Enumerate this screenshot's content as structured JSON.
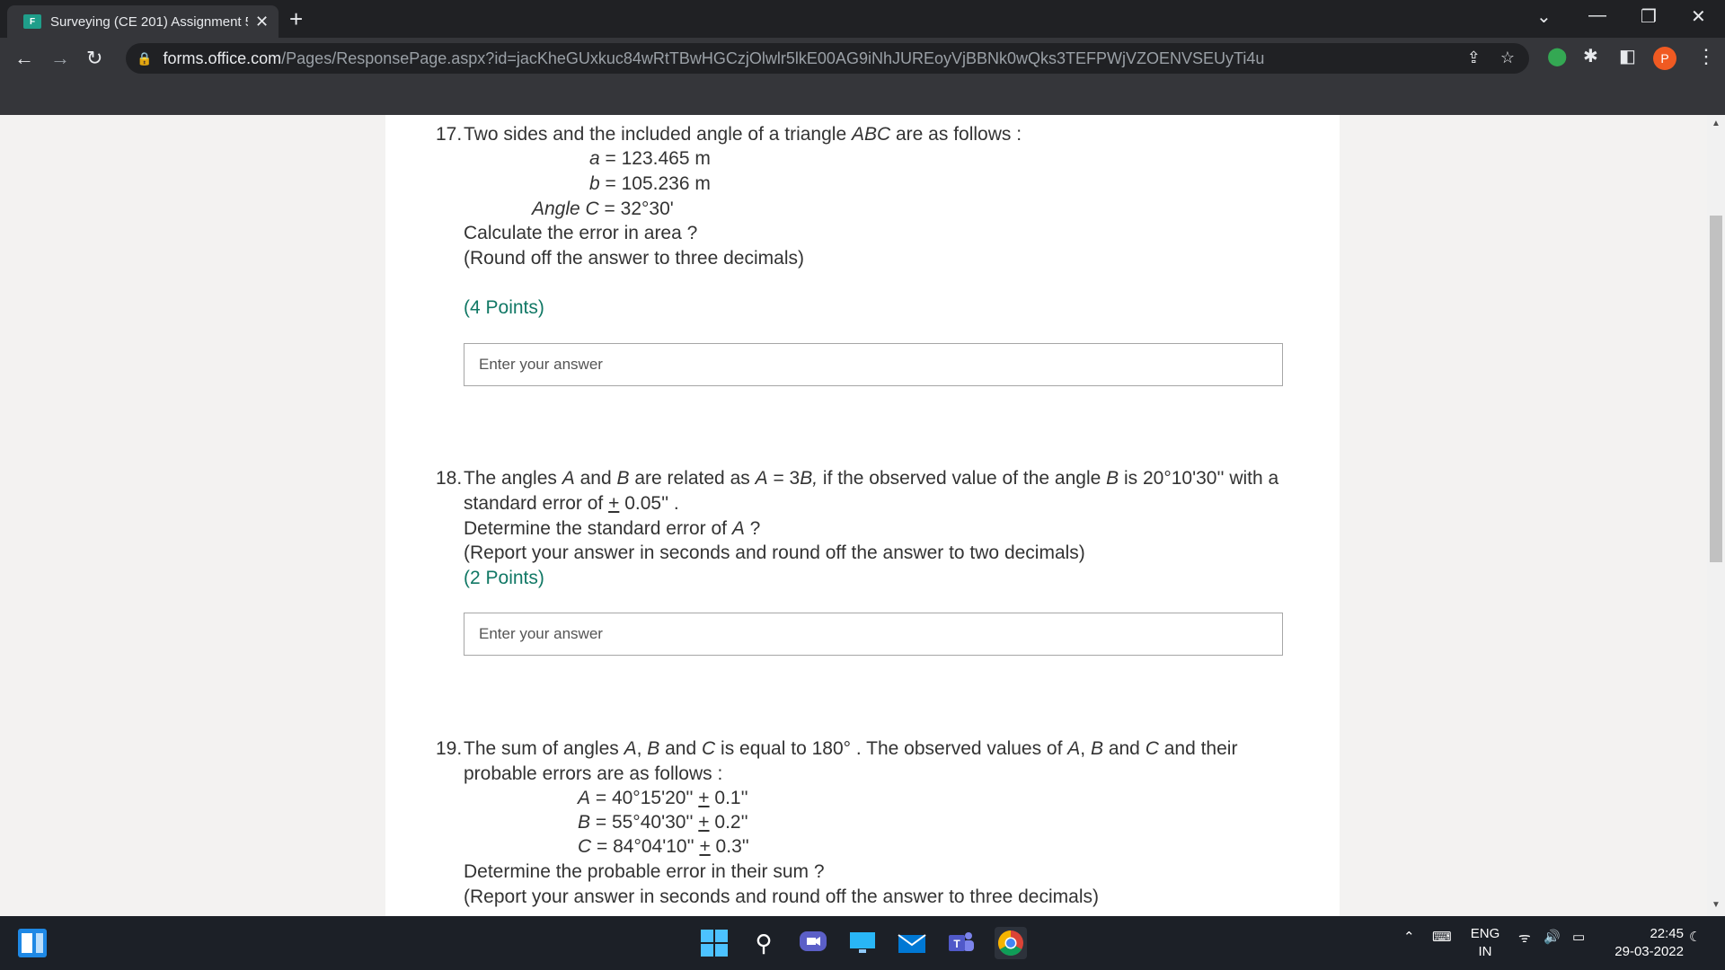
{
  "browser": {
    "tab_title": "Surveying (CE 201) Assignment 5",
    "tab_favicon": "F",
    "url_host": "forms.office.com",
    "url_path": "/Pages/ResponsePage.aspx?id=jacKheGUxkuc84wRtTBwHGCzjOlwlr5lkE00AG9iNhJUREoyVjBBNk0wQks3TEFPWjVZOENVSEUyTi4u",
    "avatar_letter": "P"
  },
  "questions": {
    "q17": {
      "number": "17.",
      "text_pre": "Two sides and the included angle of a triangle ",
      "text_it": "ABC",
      "text_post": " are as follows :",
      "a_var": "a",
      "a_val": " = 123.465 m",
      "b_var": "b",
      "b_val": " = 105.236 m",
      "c_var": "Angle C",
      "c_val": " =  32°30'",
      "line4": "Calculate the error in area ?",
      "line5": "(Round off the answer to three decimals)",
      "points": "(4 Points)",
      "placeholder": "Enter your answer"
    },
    "q18": {
      "number": "18.",
      "l1_a": "The angles ",
      "l1_A": "A",
      "l1_b": " and ",
      "l1_B": "B",
      "l1_c": " are related as ",
      "l1_A2": "A",
      "l1_d": " = 3",
      "l1_B2": "B,",
      "l1_e": " if the observed value of the angle ",
      "l1_B3": "B",
      "l1_f": " is 20°10'30'' with a",
      "l2_a": "standard error of  ",
      "l2_pm": "+",
      "l2_b": " 0.05'' .",
      "l3_a": "Determine the standard error of ",
      "l3_A": "A",
      "l3_b": " ?",
      "l4": "(Report your answer in seconds and round off the answer to two decimals)",
      "points": "(2 Points)",
      "placeholder": "Enter your answer"
    },
    "q19": {
      "number": "19.",
      "l1_a": "The sum of angles ",
      "l1_A": "A",
      "l1_b": ", ",
      "l1_B": "B",
      "l1_c": " and ",
      "l1_C": "C",
      "l1_d": " is equal to 180° . The observed values of ",
      "l1_A2": "A",
      "l1_e": ", ",
      "l1_B2": "B",
      "l1_f": " and ",
      "l1_C2": "C",
      "l1_g": " and their",
      "l2": "probable errors are as follows :",
      "a_var": "A",
      "a_val": " = 40°15'20'' ",
      "a_err": " 0.1''",
      "b_var": "B",
      "b_val": " = 55°40'30'' ",
      "b_err": " 0.2''",
      "c_var": "C",
      "c_val": " = 84°04'10'' ",
      "c_err": " 0.3''",
      "pm": "+",
      "l6": "Determine the probable error in their sum ?",
      "l7": "(Report your answer in seconds and round off the answer to three decimals)"
    }
  },
  "taskbar": {
    "lang_top": "ENG",
    "lang_bottom": "IN",
    "time": "22:45",
    "date": "29-03-2022"
  }
}
